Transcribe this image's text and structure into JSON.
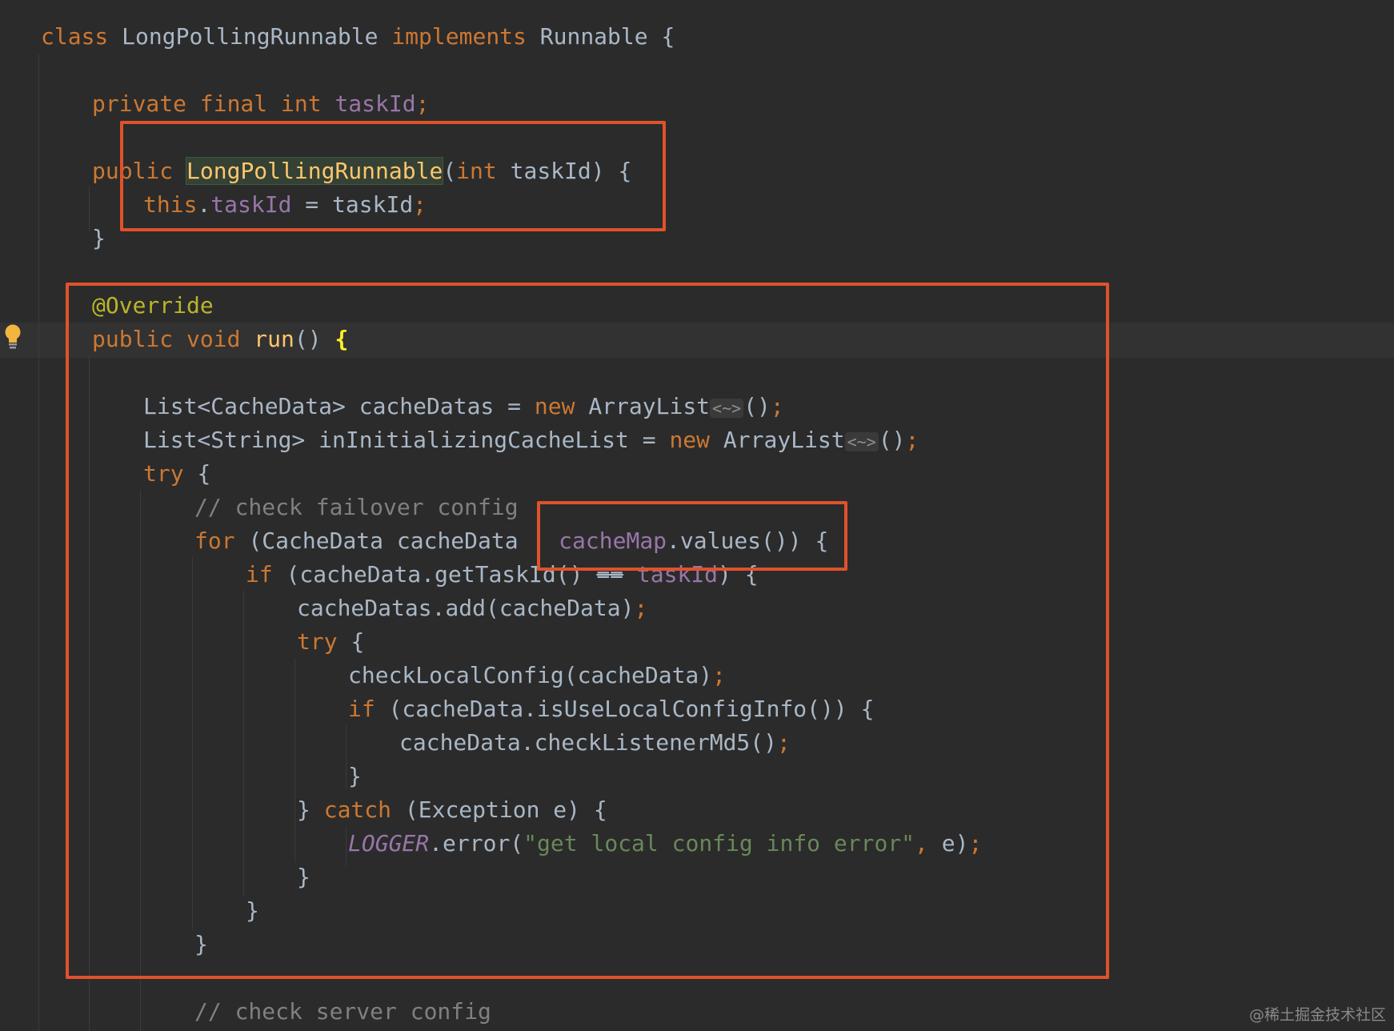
{
  "editor": {
    "colors": {
      "background": "#2b2b2b",
      "keyword": "#cc7832",
      "field": "#9876aa",
      "string": "#6a8759",
      "comment": "#808080",
      "annotation": "#bbb529",
      "method": "#ffc66d",
      "text": "#a9b7c6",
      "highlight_box": "#e0522b"
    },
    "gutter_icon": "lightbulb-icon",
    "lines": [
      [
        {
          "t": "class ",
          "c": "kw"
        },
        {
          "t": "LongPollingRunnable ",
          "c": "plain"
        },
        {
          "t": "implements ",
          "c": "kw"
        },
        {
          "t": "Runnable {",
          "c": "plain"
        }
      ],
      [],
      [
        {
          "t": "private final int ",
          "c": "kw"
        },
        {
          "t": "taskId",
          "c": "fld"
        },
        {
          "t": ";",
          "c": "kw"
        }
      ],
      [],
      [
        {
          "t": "public ",
          "c": "kw"
        },
        {
          "t": "LongPollingRunnable",
          "c": "ctor-hl"
        },
        {
          "t": "(",
          "c": "plain"
        },
        {
          "t": "int ",
          "c": "kw"
        },
        {
          "t": "taskId) {",
          "c": "plain"
        }
      ],
      [
        {
          "t": "this",
          "c": "kw"
        },
        {
          "t": ".",
          "c": "plain"
        },
        {
          "t": "taskId",
          "c": "fld"
        },
        {
          "t": " = taskId",
          "c": "plain"
        },
        {
          "t": ";",
          "c": "kw"
        }
      ],
      [
        {
          "t": "}",
          "c": "plain"
        }
      ],
      [],
      [
        {
          "t": "@Override",
          "c": "ann"
        }
      ],
      [
        {
          "t": "public void ",
          "c": "kw"
        },
        {
          "t": "run",
          "c": "fn"
        },
        {
          "t": "() ",
          "c": "plain"
        },
        {
          "t": "{",
          "c": "brace-hl"
        }
      ],
      [],
      [
        {
          "t": "List<CacheData> cacheDatas = ",
          "c": "plain"
        },
        {
          "t": "new ",
          "c": "kw"
        },
        {
          "t": "ArrayList",
          "c": "plain"
        },
        {
          "t": "<~>",
          "c": "diamond"
        },
        {
          "t": "()",
          "c": "plain"
        },
        {
          "t": ";",
          "c": "kw"
        }
      ],
      [
        {
          "t": "List<String> inInitializingCacheList = ",
          "c": "plain"
        },
        {
          "t": "new ",
          "c": "kw"
        },
        {
          "t": "ArrayList",
          "c": "plain"
        },
        {
          "t": "<~>",
          "c": "diamond"
        },
        {
          "t": "()",
          "c": "plain"
        },
        {
          "t": ";",
          "c": "kw"
        }
      ],
      [
        {
          "t": "try ",
          "c": "kw"
        },
        {
          "t": "{",
          "c": "plain"
        }
      ],
      [
        {
          "t": "// check failover config",
          "c": "cmt"
        }
      ],
      [
        {
          "t": "for ",
          "c": "kw"
        },
        {
          "t": "(CacheData cacheData : ",
          "c": "plain"
        },
        {
          "t": "cacheMap",
          "c": "fld"
        },
        {
          "t": ".values()) {",
          "c": "plain"
        }
      ],
      [
        {
          "t": "if ",
          "c": "kw"
        },
        {
          "t": "(cacheData.getTaskId() ",
          "c": "plain"
        },
        {
          "t": "==",
          "c": "strike"
        },
        {
          "t": " ",
          "c": "plain"
        },
        {
          "t": "taskId",
          "c": "fld"
        },
        {
          "t": ") {",
          "c": "plain"
        }
      ],
      [
        {
          "t": "cacheDatas.add(cacheData)",
          "c": "plain"
        },
        {
          "t": ";",
          "c": "kw"
        }
      ],
      [
        {
          "t": "try ",
          "c": "kw"
        },
        {
          "t": "{",
          "c": "plain"
        }
      ],
      [
        {
          "t": "checkLocalConfig(cacheData)",
          "c": "plain"
        },
        {
          "t": ";",
          "c": "kw"
        }
      ],
      [
        {
          "t": "if ",
          "c": "kw"
        },
        {
          "t": "(cacheData.isUseLocalConfigInfo()) {",
          "c": "plain"
        }
      ],
      [
        {
          "t": "cacheData.checkListenerMd5()",
          "c": "plain"
        },
        {
          "t": ";",
          "c": "kw"
        }
      ],
      [
        {
          "t": "}",
          "c": "plain"
        }
      ],
      [
        {
          "t": "} ",
          "c": "plain"
        },
        {
          "t": "catch ",
          "c": "kw"
        },
        {
          "t": "(Exception e) {",
          "c": "plain"
        }
      ],
      [
        {
          "t": "LOGGER",
          "c": "fld italic"
        },
        {
          "t": ".error(",
          "c": "plain"
        },
        {
          "t": "\"get local config info error\"",
          "c": "str"
        },
        {
          "t": ", ",
          "c": "kw"
        },
        {
          "t": "e)",
          "c": "plain"
        },
        {
          "t": ";",
          "c": "kw"
        }
      ],
      [
        {
          "t": "}",
          "c": "plain"
        }
      ],
      [
        {
          "t": "}",
          "c": "plain"
        }
      ],
      [
        {
          "t": "}",
          "c": "plain"
        }
      ],
      [],
      [
        {
          "t": "// check server config",
          "c": "cmt"
        }
      ]
    ]
  },
  "watermark": "@稀土掘金技术社区"
}
